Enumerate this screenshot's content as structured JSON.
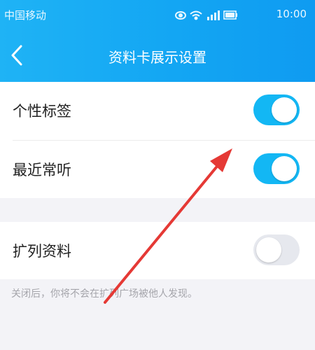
{
  "status_bar": {
    "carrier": "中国移动",
    "time": "10:00"
  },
  "nav": {
    "title": "资料卡展示设置"
  },
  "settings": {
    "group1": [
      {
        "label": "个性标签",
        "on": true
      },
      {
        "label": "最近常听",
        "on": true
      }
    ],
    "group2": [
      {
        "label": "扩列资料",
        "on": false
      }
    ],
    "hint": "关闭后，你将不会在扩列广场被他人发现。"
  },
  "colors": {
    "accent": "#13b7f4",
    "header": "#1aa9f4",
    "annotation_arrow": "#e53935"
  },
  "icons": [
    "back-arrow-icon",
    "eye-icon",
    "wifi-icon",
    "signal-icon",
    "battery-icon",
    "annotation-arrow"
  ]
}
